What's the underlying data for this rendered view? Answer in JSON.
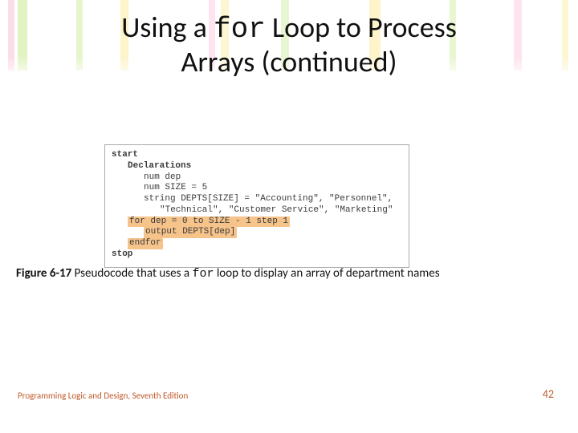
{
  "title": {
    "part1": "Using a ",
    "mono": "for",
    "part2": " Loop to Process",
    "line2": "Arrays (continued)"
  },
  "code": {
    "start": "start",
    "decl": "Declarations",
    "numdep": "num dep",
    "numsize": "num SIZE = 5",
    "depts1": "string DEPTS[SIZE] = \"Accounting\", \"Personnel\",",
    "depts2": "\"Technical\", \"Customer Service\", \"Marketing\"",
    "for": "for dep = 0 to SIZE - 1 step 1",
    "output": "output DEPTS[dep]",
    "endfor": "endfor",
    "stop": "stop"
  },
  "caption": {
    "label": "Figure 6-17",
    "pre": " Pseudocode that uses a ",
    "mono": "for",
    "post": " loop to display an array of department names"
  },
  "footer": {
    "source": "Programming Logic and Design, Seventh Edition",
    "page": "42"
  }
}
